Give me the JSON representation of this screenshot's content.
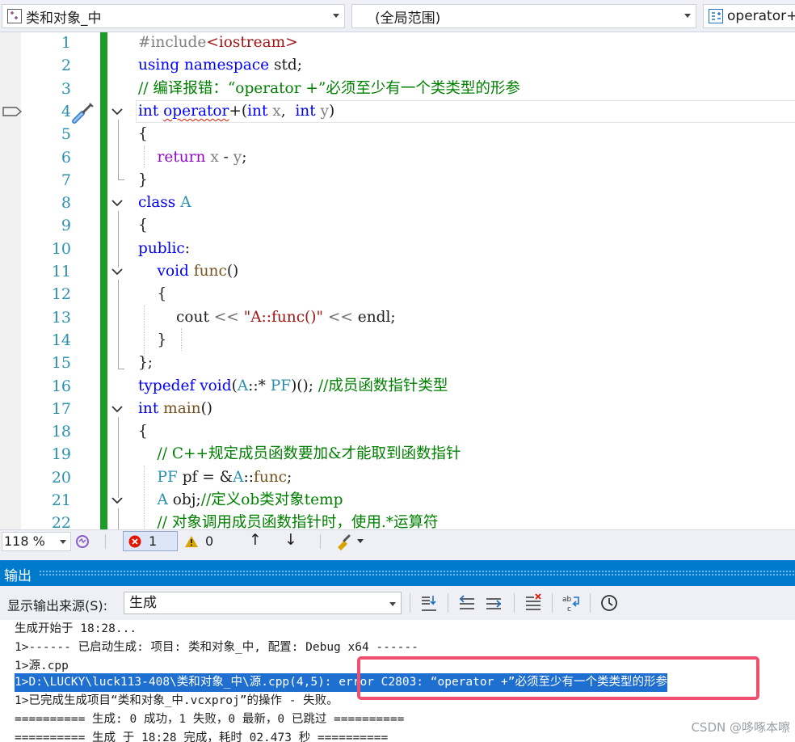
{
  "navbar": {
    "project": "类和对象_中",
    "scope": "(全局范围)",
    "member": "operator+"
  },
  "editor": {
    "line_numbers": [
      "1",
      "2",
      "3",
      "4",
      "5",
      "6",
      "7",
      "8",
      "9",
      "10",
      "11",
      "12",
      "13",
      "14",
      "15",
      "16",
      "17",
      "18",
      "19",
      "20",
      "21",
      "22"
    ],
    "lines": [
      [
        {
          "t": "#include",
          "c": "pp"
        },
        {
          "t": "<iostream>",
          "c": "inc"
        }
      ],
      [
        {
          "t": "using",
          "c": "kw"
        },
        {
          "t": " "
        },
        {
          "t": "namespace",
          "c": "kw"
        },
        {
          "t": " std;"
        }
      ],
      [
        {
          "t": "// 编译报错：“operator +”必须至少有一个类类型的形参",
          "c": "cm"
        }
      ],
      [
        {
          "t": "int",
          "c": "kw"
        },
        {
          "t": " "
        },
        {
          "t": "operator",
          "c": "kw squiggle"
        },
        {
          "t": "+(",
          "c": ""
        },
        {
          "t": "int",
          "c": "kw"
        },
        {
          "t": " "
        },
        {
          "t": "x",
          "c": "par"
        },
        {
          "t": ",  "
        },
        {
          "t": "int",
          "c": "kw"
        },
        {
          "t": " "
        },
        {
          "t": "y",
          "c": "par"
        },
        {
          "t": ")"
        }
      ],
      [
        {
          "t": "{"
        }
      ],
      [
        {
          "t": "    "
        },
        {
          "t": "return",
          "c": "pur"
        },
        {
          "t": " "
        },
        {
          "t": "x",
          "c": "par"
        },
        {
          "t": " - "
        },
        {
          "t": "y",
          "c": "par"
        },
        {
          "t": ";"
        }
      ],
      [
        {
          "t": "}"
        }
      ],
      [
        {
          "t": "class",
          "c": "kw"
        },
        {
          "t": " "
        },
        {
          "t": "A",
          "c": "ty"
        }
      ],
      [
        {
          "t": "{"
        }
      ],
      [
        {
          "t": "public",
          "c": "kw"
        },
        {
          "t": ":"
        }
      ],
      [
        {
          "t": "    "
        },
        {
          "t": "void",
          "c": "kw"
        },
        {
          "t": " "
        },
        {
          "t": "func",
          "c": "fn"
        },
        {
          "t": "()"
        }
      ],
      [
        {
          "t": "    "
        },
        {
          "t": "{"
        }
      ],
      [
        {
          "t": "        cout "
        },
        {
          "t": "<<",
          "c": "gry"
        },
        {
          "t": " "
        },
        {
          "t": "\"A::func()\"",
          "c": "str"
        },
        {
          "t": " "
        },
        {
          "t": "<<",
          "c": "gry"
        },
        {
          "t": " endl;"
        }
      ],
      [
        {
          "t": "    "
        },
        {
          "t": "}"
        }
      ],
      [
        {
          "t": "};"
        }
      ],
      [
        {
          "t": "typedef",
          "c": "kw"
        },
        {
          "t": " "
        },
        {
          "t": "void",
          "c": "kw"
        },
        {
          "t": "("
        },
        {
          "t": "A",
          "c": "ty"
        },
        {
          "t": "::* "
        },
        {
          "t": "PF",
          "c": "ty"
        },
        {
          "t": ")(); "
        },
        {
          "t": "//成员函数指针类型",
          "c": "cm"
        }
      ],
      [
        {
          "t": "int",
          "c": "kw"
        },
        {
          "t": " "
        },
        {
          "t": "main",
          "c": "fn"
        },
        {
          "t": "()"
        }
      ],
      [
        {
          "t": "{"
        }
      ],
      [
        {
          "t": "    "
        },
        {
          "t": "// C++规定成员函数要加&才能取到函数指针",
          "c": "cm"
        }
      ],
      [
        {
          "t": "    "
        },
        {
          "t": "PF",
          "c": "ty"
        },
        {
          "t": " pf = &"
        },
        {
          "t": "A",
          "c": "ty"
        },
        {
          "t": "::"
        },
        {
          "t": "func",
          "c": "fn"
        },
        {
          "t": ";"
        }
      ],
      [
        {
          "t": "    "
        },
        {
          "t": "A",
          "c": "ty"
        },
        {
          "t": " obj;"
        },
        {
          "t": "//定义ob类对象temp",
          "c": "cm"
        }
      ],
      [
        {
          "t": "    "
        },
        {
          "t": "// 对象调用成员函数指针时，使用.*运算符",
          "c": "cm"
        }
      ]
    ]
  },
  "status": {
    "zoom": "118 %",
    "errors": "1",
    "warnings": "0"
  },
  "output": {
    "title": "输出",
    "source_label": "显示输出来源(S):",
    "source_value": "生成",
    "lines": [
      "生成开始于 18:28...",
      "1>------ 已启动生成: 项目: 类和对象_中, 配置: Debug x64 ------",
      "1>源.cpp",
      "1>D:\\LUCKY\\luck113-408\\类和对象_中\\源.cpp(4,5): error C2803: “operator +”必须至少有一个类类型的形参",
      "1>已完成生成项目“类和对象_中.vcxproj”的操作 - 失败。",
      "========== 生成: 0 成功，1 失败，0 最新，0 已跳过 ==========",
      "========== 生成 于 18:28 完成，耗时 02.473 秒 =========="
    ]
  },
  "watermark": "CSDN @哆啄本嚓",
  "colors": {
    "accent": "#007acc",
    "change_bar": "#1b9b2a",
    "selection": "#1f6fd0",
    "annotation_box": "#f0506e"
  }
}
